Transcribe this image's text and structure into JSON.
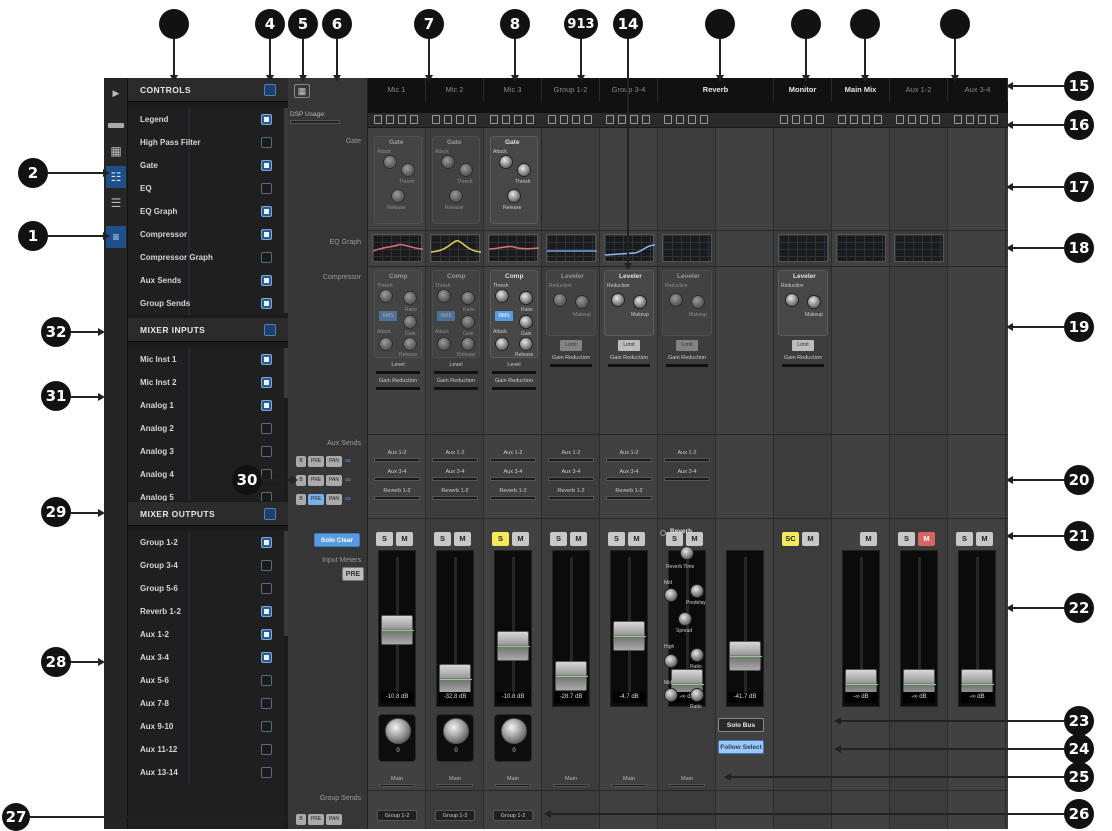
{
  "callouts": [
    "1",
    "2",
    "4",
    "5",
    "6",
    "7",
    "8",
    "9",
    "13",
    "14",
    "15",
    "16",
    "17",
    "18",
    "19",
    "20",
    "21",
    "22",
    "23",
    "24",
    "25",
    "26",
    "27",
    "28",
    "29",
    "30",
    "31",
    "32"
  ],
  "controls": {
    "title": "CONTROLS",
    "items": [
      {
        "label": "Legend",
        "checked": true
      },
      {
        "label": "High Pass Filter",
        "checked": false
      },
      {
        "label": "Gate",
        "checked": true
      },
      {
        "label": "EQ",
        "checked": false
      },
      {
        "label": "EQ Graph",
        "checked": true
      },
      {
        "label": "Compressor",
        "checked": true
      },
      {
        "label": "Compressor Graph",
        "checked": false
      },
      {
        "label": "Aux Sends",
        "checked": true
      },
      {
        "label": "Group Sends",
        "checked": true
      }
    ]
  },
  "mixer_inputs": {
    "title": "MIXER INPUTS",
    "items": [
      {
        "label": "Mic Inst 1",
        "checked": true
      },
      {
        "label": "Mic Inst 2",
        "checked": true
      },
      {
        "label": "Analog 1",
        "checked": true
      },
      {
        "label": "Analog 2",
        "checked": false
      },
      {
        "label": "Analog 3",
        "checked": false
      },
      {
        "label": "Analog 4",
        "checked": false
      },
      {
        "label": "Analog 5",
        "checked": false
      }
    ]
  },
  "mixer_outputs": {
    "title": "MIXER OUTPUTS",
    "items": [
      {
        "label": "Group 1-2",
        "checked": true
      },
      {
        "label": "Group 3-4",
        "checked": false
      },
      {
        "label": "Group 5-6",
        "checked": false
      },
      {
        "label": "Reverb 1-2",
        "checked": true
      },
      {
        "label": "Aux 1-2",
        "checked": true
      },
      {
        "label": "Aux 3-4",
        "checked": true
      },
      {
        "label": "Aux 5-6",
        "checked": false
      },
      {
        "label": "Aux 7-8",
        "checked": false
      },
      {
        "label": "Aux 9-10",
        "checked": false
      },
      {
        "label": "Aux 11-12",
        "checked": false
      },
      {
        "label": "Aux 13-14",
        "checked": false
      }
    ]
  },
  "mixer": {
    "dsp_label": "DSP Usage:",
    "row_labels": {
      "gate": "Gate",
      "eq_graph": "EQ Graph",
      "compressor": "Compressor",
      "aux_sends": "Aux Sends",
      "input_meters": "Input Meters",
      "group_sends": "Group Sends"
    },
    "channels": [
      "Mic 1",
      "Mic 2",
      "Mic 3",
      "Group 1-2",
      "Group 3-4",
      "Reverb",
      "Monitor",
      "Main Mix",
      "Aux 1-2",
      "Aux 3-4"
    ],
    "gate": {
      "title": "Gate",
      "attack": "Attack",
      "thresh": "Thresh",
      "release": "Release"
    },
    "comp": {
      "title": "Comp",
      "thresh": "Thresh",
      "ratio": "Ratio",
      "rms": "RMS",
      "gain": "Gain",
      "attack": "Attack",
      "release": "Release",
      "level": "Level",
      "gain_reduction": "Gain Reduction"
    },
    "leveler": {
      "title": "Leveler",
      "reduction": "Reduction",
      "makeup": "Makeup",
      "limit": "Limit",
      "gain_reduction": "Gain Reduction"
    },
    "sends": {
      "aux12": "Aux 1-2",
      "aux34": "Aux 3-4",
      "reverb12": "Reverb 1-2",
      "bus_btn": "B",
      "pre_btn": "PRE",
      "pan_btn": "PAN"
    },
    "solo_clear": "Solo Clear",
    "pre": "PRE",
    "solo": "S",
    "mute": "M",
    "sc": "SC",
    "fader_db": [
      "-10.8 dB",
      "-32.8 dB",
      "-10.8 dB",
      "-28.7 dB",
      "-4.7 dB",
      "-∞ dB",
      "-41.7 dB",
      "-∞ dB",
      "-∞ dB",
      "-∞ dB"
    ],
    "pan_value": "0",
    "main": "Main",
    "group12": "Group 1-2",
    "reverb": {
      "title": "Reverb",
      "reverb_time": "Reverb Time",
      "mid": "Mid",
      "predelay": "Predelay",
      "spread": "Spread",
      "high": "High",
      "ratio": "Ratio",
      "low": "Mid",
      "ratio2": "Ratio"
    },
    "solo_bus": "Solo Bus",
    "follow_select": "Follow Select"
  },
  "colors": {
    "accent_blue": "#5a9be0",
    "solo_yellow": "#f2ea59",
    "mute_red": "#d86565",
    "panel_bg": "#1b1b1b"
  }
}
